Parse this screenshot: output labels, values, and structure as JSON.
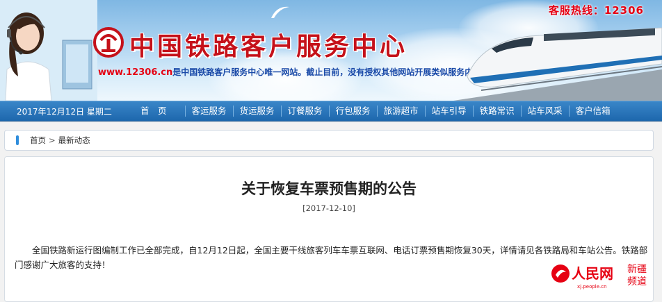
{
  "header": {
    "hotline": "客服热线：12306",
    "site_title": "中国铁路客户服务中心",
    "notice_url": "www.12306.cn",
    "notice_text": "是中国铁路客户服务中心唯一网站。截止目前，没有授权其他网站开展类似服务内容，敬请广大用户注意"
  },
  "nav": {
    "date": "2017年12月12日 星期二",
    "items": [
      "首　页",
      "客运服务",
      "货运服务",
      "订餐服务",
      "行包服务",
      "旅游超市",
      "站车引导",
      "铁路常识",
      "站车风采",
      "客户信箱"
    ]
  },
  "breadcrumb": {
    "home": "首页",
    "separator": ">",
    "current": "最新动态"
  },
  "article": {
    "title": "关于恢复车票预售期的公告",
    "date": "[2017-12-10]",
    "body": "全国铁路新运行图编制工作已全部完成，自12月12日起，全国主要干线旅客列车车票互联网、电话订票预售期恢复30天，详情请见各铁路局和车站公告。铁路部门感谢广大旅客的支持！"
  },
  "watermark": {
    "brand": "人民网",
    "channel_line1": "新疆",
    "channel_line2": "频道",
    "domain": "xj.people.cn"
  },
  "colors": {
    "nav_blue": "#1d67ad",
    "title_red": "#c5111a",
    "notice_blue": "#1a4aa8",
    "hotline_red": "#e60012"
  }
}
